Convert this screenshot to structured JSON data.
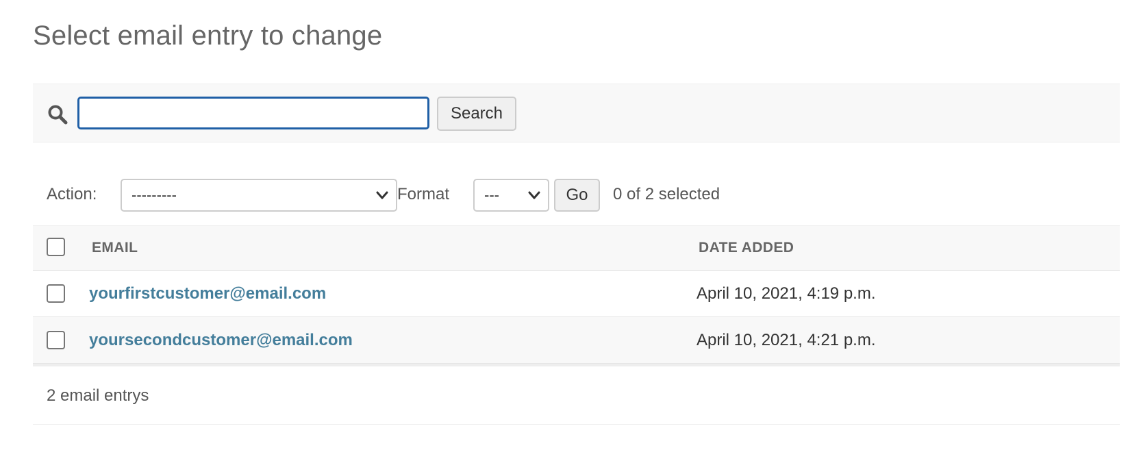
{
  "page": {
    "title": "Select email entry to change"
  },
  "search": {
    "value": "",
    "placeholder": "",
    "button_label": "Search",
    "icon": "search-icon"
  },
  "actions": {
    "action_label": "Action:",
    "action_selected": "---------",
    "format_label": "Format",
    "format_selected": "---",
    "go_label": "Go",
    "selection_count": "0 of 2 selected"
  },
  "table": {
    "columns": [
      "EMAIL",
      "DATE ADDED"
    ],
    "rows": [
      {
        "email": "yourfirstcustomer@email.com",
        "date_added": "April 10, 2021, 4:19 p.m."
      },
      {
        "email": "yoursecondcustomer@email.com",
        "date_added": "April 10, 2021, 4:21 p.m."
      }
    ]
  },
  "paginator": {
    "result_count": "2 email entrys"
  },
  "colors": {
    "link": "#447e9b",
    "focus_border": "#1f5fa6",
    "toolbar_bg": "#f8f8f8"
  }
}
